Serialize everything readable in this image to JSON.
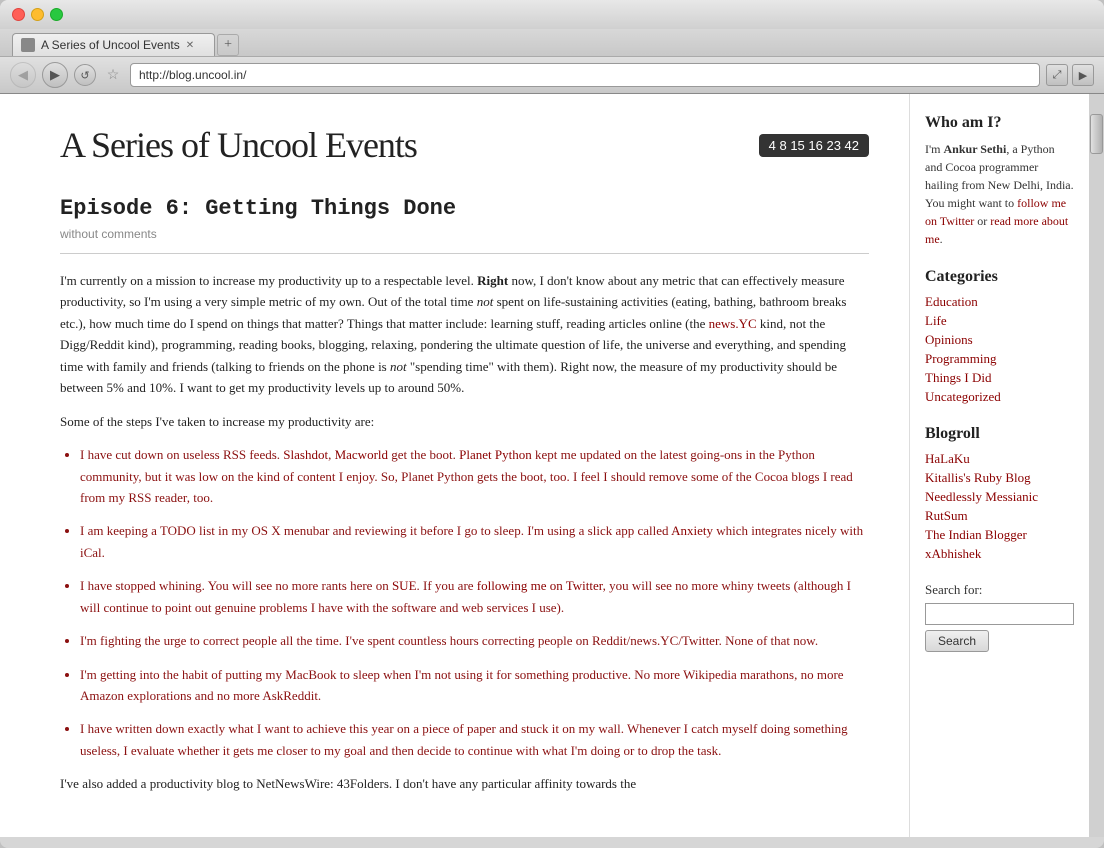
{
  "browser": {
    "tab_title": "A Series of Uncool Events",
    "url": "http://blog.uncool.in/",
    "back_icon": "◀",
    "forward_icon": "▶",
    "reload_icon": "↺",
    "star_icon": "☆",
    "resize_icon": "⤢",
    "nav_icon": "▶"
  },
  "site": {
    "title": "A Series of Uncool Events",
    "lottery": "4  8  15  16  23  42"
  },
  "article": {
    "title": "Episode 6: Getting Things Done",
    "meta": "without comments",
    "paragraphs": [
      "I'm currently on a mission to increase my productivity up to a respectable level. Right now, I don't know about any metric that can effectively measure productivity, so I'm using a very simple metric of my own. Out of the total time not spent on life-sustaining activities (eating, bathing, bathroom breaks etc.), how much time do I spend on things that matter? Things that matter include: learning stuff, reading articles online (the news.YC kind, not the Digg/Reddit kind), programming, reading books, blogging, relaxing, pondering the ultimate question of life, the universe and everything, and spending time with family and friends (talking to friends on the phone is not \"spending time\" with them). Right now, the measure of my productivity should be between 5% and 10%. I want to get my productivity levels up to around 50%.",
      "Some of the steps I've taken to increase my productivity are:"
    ],
    "list_items": [
      "I have cut down on useless RSS feeds. Slashdot, Macworld get the boot. Planet Python kept me updated on the latest going-ons in the Python community, but it was low on the kind of content I enjoy. So, Planet Python gets the boot, too. I feel I should remove some of the Cocoa blogs I read from my RSS reader, too.",
      "I am keeping a TODO list in my OS X menubar and reviewing it before I go to sleep. I'm using a slick app called Anxiety which integrates nicely with iCal.",
      "I have stopped whining. You will see no more rants here on SUE. If you are following me on Twitter, you will see no more whiny tweets (although I will continue to point out genuine problems I have with the software and web services I use).",
      "I'm fighting the urge to correct people all the time. I've spent countless hours correcting people on Reddit/news.YC/Twitter. None of that now.",
      "I'm getting into the habit of putting my MacBook to sleep when I'm not using it for something productive. No more Wikipedia marathons, no more Amazon explorations and no more AskReddit.",
      "I have written down exactly what I want to achieve this year on a piece of paper and stuck it on my wall. Whenever I catch myself doing something useless, I evaluate whether it gets me closer to my goal and then decide to continue with what I'm doing or to drop the task."
    ],
    "final_para": "I've also added a productivity blog to NetNewsWire: 43Folders. I don't have any particular affinity towards the"
  },
  "sidebar": {
    "who_heading": "Who am I?",
    "who_text": "I'm Ankur Sethi, a Python and Cocoa programmer hailing from New Delhi, India. You might want to follow me on Twitter or read more about me.",
    "categories_heading": "Categories",
    "categories": [
      "Education",
      "Life",
      "Opinions",
      "Programming",
      "Things I Did",
      "Uncategorized"
    ],
    "blogroll_heading": "Blogroll",
    "blogroll": [
      "HaLaKu",
      "Kitallis's Ruby Blog",
      "Needlessly Messianic",
      "RutSum",
      "The Indian Blogger",
      "xAbhishek"
    ],
    "search_label": "Search for:",
    "search_placeholder": "",
    "search_button": "Search"
  }
}
